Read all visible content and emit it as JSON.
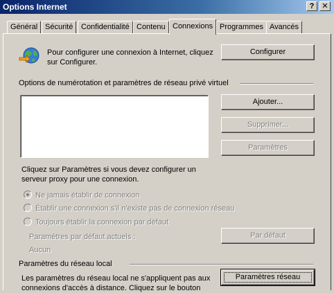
{
  "window": {
    "title": "Options Internet",
    "help_glyph": "?",
    "close_glyph": "✕"
  },
  "tabs": [
    {
      "label": "Général",
      "active": false
    },
    {
      "label": "Sécurité",
      "active": false
    },
    {
      "label": "Confidentialité",
      "active": false
    },
    {
      "label": "Contenu",
      "active": false
    },
    {
      "label": "Connexions",
      "active": true
    },
    {
      "label": "Programmes",
      "active": false
    },
    {
      "label": "Avancés",
      "active": false
    }
  ],
  "setup": {
    "text_line1": "Pour configurer une connexion à Internet, cliquez",
    "text_line2": "sur Configurer.",
    "button": "Configurer",
    "icon": "globe-connection-icon"
  },
  "dialup": {
    "heading": "Options de numérotation et paramètres de réseau privé virtuel",
    "add_button": "Ajouter...",
    "remove_button": "Supprimer...",
    "settings_button": "Paramètres",
    "proxy_text_line1": "Cliquez sur Paramètres si vous devez configurer un",
    "proxy_text_line2": "serveur proxy pour une connexion.",
    "radio_never": "Ne jamais établir de connexion",
    "radio_if_none": "Établir une connexion s'il n'existe pas de connexion réseau",
    "radio_always": "Toujours établir la connexion par défaut",
    "current_default_label": "Paramètres par défaut actuels :",
    "current_default_value": "Aucun",
    "default_button": "Par défaut"
  },
  "lan": {
    "heading": "Paramètres du réseau local",
    "text_line1": "Les paramètres du réseau local ne s'appliquent pas aux",
    "text_line2": "connexions d'accès à distance. Cliquez sur le bouton",
    "button": "Paramètres réseau"
  },
  "colors": {
    "face": "#d4d0c8",
    "title_start": "#0a246a",
    "title_end": "#a6caf0",
    "disabled_text": "#808080"
  }
}
